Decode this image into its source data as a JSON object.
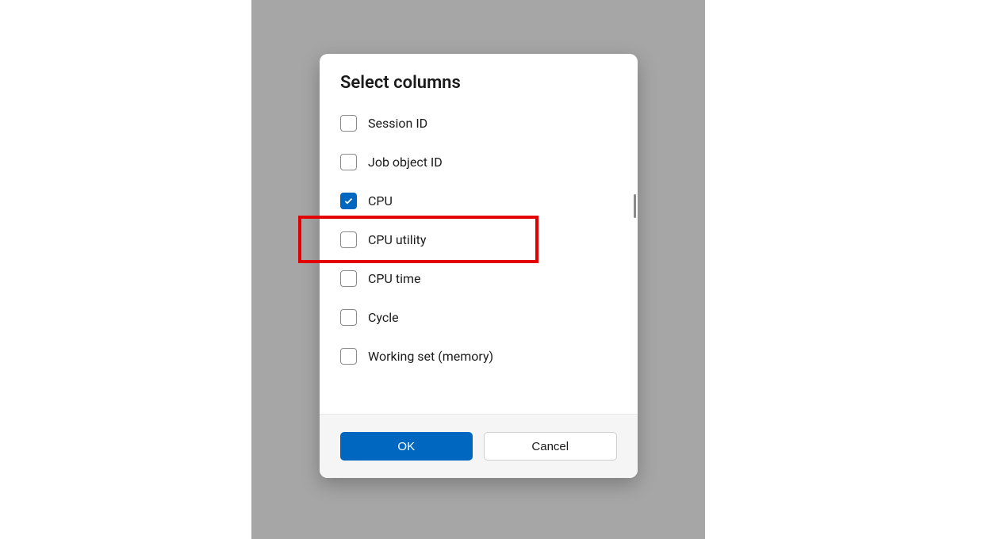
{
  "dialog": {
    "title": "Select columns",
    "options": [
      {
        "label": "Session ID",
        "checked": false
      },
      {
        "label": "Job object ID",
        "checked": false
      },
      {
        "label": "CPU",
        "checked": true
      },
      {
        "label": "CPU utility",
        "checked": false
      },
      {
        "label": "CPU time",
        "checked": false
      },
      {
        "label": "Cycle",
        "checked": false
      },
      {
        "label": "Working set (memory)",
        "checked": false
      }
    ],
    "buttons": {
      "ok": "OK",
      "cancel": "Cancel"
    }
  },
  "highlight": {
    "target_index": 3
  }
}
